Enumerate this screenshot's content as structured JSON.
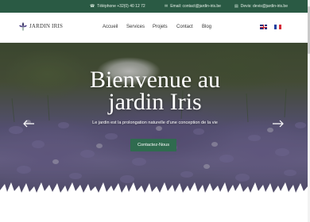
{
  "topbar": {
    "phone": "Téléphone +32(0) 40 12 72",
    "email": "Email: contact@jardin-iris.be",
    "devis": "Devis: devis@jardin-iris.be",
    "icons": [
      "phone-icon",
      "envelope-icon",
      "document-icon"
    ]
  },
  "header": {
    "logo_text": "JARDIN IRIS",
    "nav": {
      "accueil": "Accueil",
      "services": "Services",
      "projets": "Projets",
      "contact": "Contact",
      "blog": "Blog"
    },
    "languages": [
      "English flag",
      "French flag"
    ]
  },
  "hero": {
    "title_line1": "Bienvenue au",
    "title_line2": "jardin Iris",
    "subtitle": "Le jardin est la prolongation naturelle d'une conception de la vie",
    "cta_label": "Contactez-Nous"
  },
  "colors": {
    "brand_green": "#2a5a44",
    "cta_green": "#2f6b4f",
    "text_dark": "#333333",
    "white": "#ffffff"
  }
}
